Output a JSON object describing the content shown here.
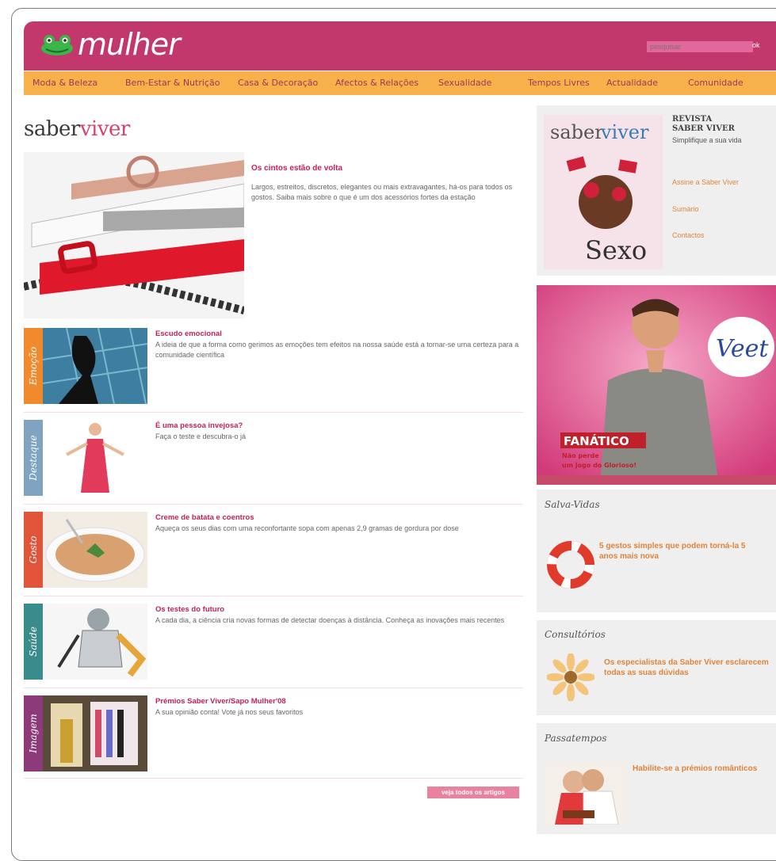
{
  "header": {
    "logo_text": "mulher",
    "search_placeholder": "pesquisar",
    "search_button": "ok",
    "nav": [
      "Moda & Beleza",
      "Bem-Estar & Nutrição",
      "Casa & Decoração",
      "Afectos & Relações",
      "Sexualidade",
      "Tempos Livres",
      "Actualidade",
      "Comunidade"
    ]
  },
  "brand": {
    "part1": "saber",
    "part2": "viver"
  },
  "feature": {
    "title": "Os cintos estão de volta",
    "description": "Largos, estreitos, discretos, elegantes ou mais extravagantes, há-os para todos os gostos. Saiba mais sobre o que é um dos acessórios fortes da estação"
  },
  "articles": [
    {
      "tab": "Emoção",
      "tab_color": "#f08a2c",
      "title": "Escudo emocional",
      "description": "A ideia de que a forma como gerimos as emoções tem efeitos na nossa saúde está a tornar-se uma certeza para a comunidade científica"
    },
    {
      "tab": "Destaque",
      "tab_color": "#7fa3c0",
      "title": "É uma pessoa invejosa?",
      "description": "Faça o teste e descubra-o já"
    },
    {
      "tab": "Gosto",
      "tab_color": "#e0553a",
      "title": "Creme de batata e coentros",
      "description": "Aqueça os seus dias com uma reconfortante sopa com apenas 2,9 gramas de gordura por dose"
    },
    {
      "tab": "Saúde",
      "tab_color": "#3a8c8c",
      "title": "Os testes do futuro",
      "description": "A cada dia, a ciência cria novas formas de detectar doenças à distância. Conheça as inovações mais recentes"
    },
    {
      "tab": "Imagem",
      "tab_color": "#8c3a7a",
      "title": "Prémios Saber Viver/Sapo Mulher'08",
      "description": "A sua opinião conta! Vote já nos seus favoritos"
    }
  ],
  "more_button": "veja todos os artigos",
  "sidebar": {
    "magazine": {
      "title_line1": "REVISTA",
      "title_line2": "SABER VIVER",
      "subtitle": "Simplifique a sua vida",
      "links": [
        "Assine a Saber Viver",
        "Sumário",
        "Contactos"
      ],
      "cover_logo1": "saber",
      "cover_logo2": "viver",
      "cover_word": "Sexo"
    },
    "ad": {
      "brand": "Veet",
      "headline": "FANÁTICO",
      "line1": "Não perde",
      "line2": "um jogo do Glorioso!"
    },
    "salva_vidas": {
      "label": "Salva-Vidas",
      "text": "5 gestos simples que podem torná-la 5 anos mais nova"
    },
    "consultorios": {
      "label": "Consultórios",
      "text": "Os especialistas da Saber Viver esclarecem todas as suas dúvidas"
    },
    "passatempos": {
      "label": "Passatempos",
      "text": "Habilite-se a prémios românticos"
    }
  }
}
